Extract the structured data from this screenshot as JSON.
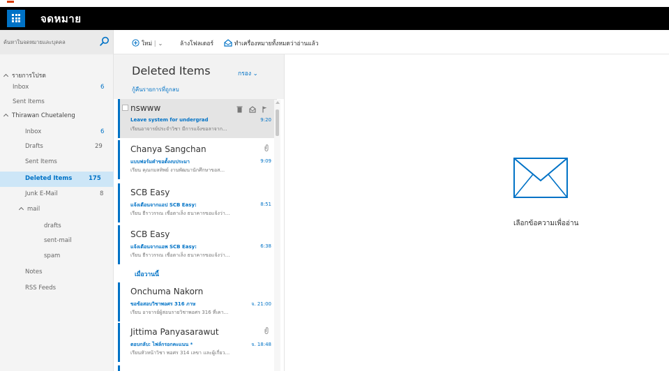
{
  "app": {
    "title": "จดหมาย"
  },
  "search": {
    "placeholder": "ค้นหาในจดหมายและบุคคล"
  },
  "commands": {
    "new_label": "ใหม่",
    "folders_label": "ล้างโฟลเดอร์",
    "mark_all_read_label": "ทำเครื่องหมายทั้งหมดว่าอ่านแล้ว"
  },
  "sidebar": {
    "favorites_label": "รายการโปรด",
    "favorites": [
      {
        "label": "Inbox",
        "count": "6"
      },
      {
        "label": "Sent Items",
        "count": ""
      }
    ],
    "account_label": "Thirawan Chuetaleng",
    "folders": [
      {
        "label": "Inbox",
        "count": "6"
      },
      {
        "label": "Drafts",
        "count": "29"
      },
      {
        "label": "Sent Items",
        "count": ""
      },
      {
        "label": "Deleted Items",
        "count": "175"
      },
      {
        "label": "Junk E-Mail",
        "count": "8"
      }
    ],
    "mail_label": "mail",
    "mail_sub": [
      "drafts",
      "sent-mail",
      "spam"
    ],
    "bottom": [
      "Notes",
      "RSS Feeds"
    ]
  },
  "list": {
    "title": "Deleted Items",
    "filter_label": "กรอง",
    "recover_label": "กู้คืนรายการที่ถูกลบ",
    "group_label": "เมื่อวานนี้",
    "messages": [
      {
        "sender": "nswww",
        "subject": "Leave system for undergrad",
        "time": "9:20",
        "preview": "เรียนอาจารย์ประจำวิชา มีการแจ้งขอลาจาก..."
      },
      {
        "sender": "Chanya Sangchan",
        "subject": "แบบฟอร์มคำขอตั้งงบประมา",
        "time": "9:09",
        "preview": "เรียน คุณกมลทิพย์ งานพัฒนานักศึกษาขอส..."
      },
      {
        "sender": "SCB Easy",
        "subject": "แจ้งเตือนจากแอป SCB Easy:",
        "time": "8:51",
        "preview": "เรียน ธีราวรรณ เชื่อตาเล็ง ธนาคารขอแจ้งว่า..."
      },
      {
        "sender": "SCB Easy",
        "subject": "แจ้งเตือนจากแอพ SCB Easy:",
        "time": "6:38",
        "preview": "เรียน ธีราวรรณ เชื่อตาเล็ง ธนาคารขอแจ้งว่า..."
      },
      {
        "sender": "Onchuma Nakorn",
        "subject": "ขอข้อสอบวิชาพอศร 316 ภาษ",
        "time": "จ. 21:00",
        "preview": "เรียน อาจารย์ผู้สอนรายวิชาพอศร 316 ที่เคา..."
      },
      {
        "sender": "Jittima Panyasarawut",
        "subject": "ตอบกลับ: ไฟล์กรอกคะแนน *",
        "time": "จ. 18:48",
        "preview": "เรียนหัวหน้าวิชา พอศร 314 เลขา และผู้เกี่ยว..."
      }
    ]
  },
  "reading": {
    "empty_label": "เลือกข้อความเพื่ออ่าน"
  },
  "colors": {
    "accent": "#0072c6",
    "header": "#000000",
    "selected_folder": "#cde6f7"
  }
}
